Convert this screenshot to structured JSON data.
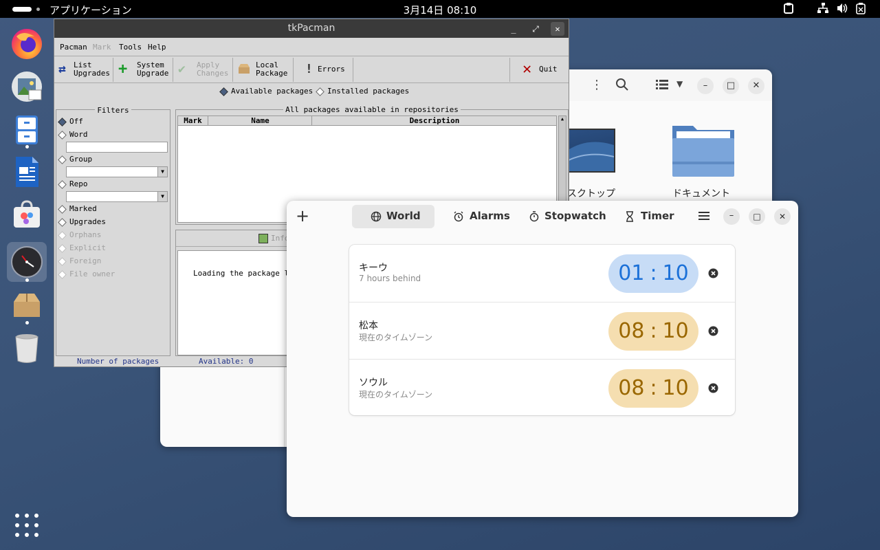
{
  "topbar": {
    "apps_label": "アプリケーション",
    "clock": "3月14日 08:10"
  },
  "dock": {
    "items": [
      "firefox-icon",
      "image-viewer-icon",
      "file-cabinet-icon",
      "writer-icon",
      "software-store-icon",
      "clocks-icon",
      "package-manager-icon",
      "trash-icon"
    ]
  },
  "files_window": {
    "folder1_label": "スクトップ",
    "folder2_label": "ドキュメント"
  },
  "tkpacman": {
    "title": "tkPacman",
    "menu": [
      "Pacman",
      "Mark",
      "Tools",
      "Help"
    ],
    "toolbar": {
      "list_upgrades": [
        "List",
        "Upgrades"
      ],
      "system_upgrade": [
        "System",
        "Upgrade"
      ],
      "apply_changes": [
        "Apply",
        "Changes"
      ],
      "local_package": [
        "Local",
        "Package"
      ],
      "errors": "Errors",
      "quit": "Quit"
    },
    "source": {
      "available": "Available packages",
      "installed": "Installed packages"
    },
    "filters": {
      "legend": "Filters",
      "off": "Off",
      "word": "Word",
      "group": "Group",
      "repo": "Repo",
      "marked": "Marked",
      "upgrades": "Upgrades",
      "orphans": "Orphans",
      "explicit": "Explicit",
      "foreign": "Foreign",
      "file_owner": "File owner"
    },
    "packages": {
      "legend": "All packages available in repositories",
      "col_mark": "Mark",
      "col_name": "Name",
      "col_desc": "Description"
    },
    "info_tab": "Info",
    "loading": "Loading the package lis",
    "status": {
      "count_label": "Number of packages",
      "available": "Available: 0"
    }
  },
  "clocks": {
    "tabs": [
      "World",
      "Alarms",
      "Stopwatch",
      "Timer"
    ],
    "cities": [
      {
        "name": "キーウ",
        "desc": "7 hours behind",
        "time_h": "01",
        "time_m": "10",
        "style": "night"
      },
      {
        "name": "松本",
        "desc": "現在のタイムゾーン",
        "time_h": "08",
        "time_m": "10",
        "style": "day"
      },
      {
        "name": "ソウル",
        "desc": "現在のタイムゾーン",
        "time_h": "08",
        "time_m": "10",
        "style": "day"
      }
    ],
    "colors": {
      "night_bg": "#c7dcf6",
      "night_fg": "#1c71d8",
      "day_bg": "#f5deb0",
      "day_fg": "#9a6700"
    }
  }
}
